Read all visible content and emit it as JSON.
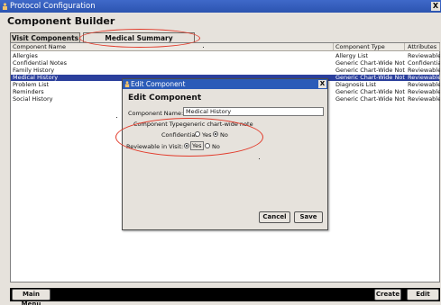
{
  "window": {
    "title": "Protocol Configuration",
    "close_glyph": "X"
  },
  "page": {
    "heading": "Component Builder"
  },
  "tabs": [
    {
      "label": "Visit Components"
    },
    {
      "label": "Medical Summary Components"
    }
  ],
  "table": {
    "columns": [
      "Component Name",
      "Component Type",
      "Attributes"
    ],
    "rows": [
      {
        "name": "Allergies",
        "type": "Allergy List",
        "attr": "Reviewable"
      },
      {
        "name": "Confidential Notes",
        "type": "Generic Chart-Wide Note",
        "attr": "Confidential"
      },
      {
        "name": "Family History",
        "type": "Generic Chart-Wide Note",
        "attr": "Reviewable"
      },
      {
        "name": "Medical History",
        "type": "Generic Chart-Wide Note",
        "attr": "Reviewable"
      },
      {
        "name": "Problem List",
        "type": "Diagnosis List",
        "attr": "Reviewable"
      },
      {
        "name": "Reminders",
        "type": "Generic Chart-Wide Note",
        "attr": "Reviewable"
      },
      {
        "name": "Social History",
        "type": "Generic Chart-Wide Note",
        "attr": "Reviewable"
      }
    ]
  },
  "dialog": {
    "title": "Edit Component",
    "close_glyph": "X",
    "heading": "Edit Component",
    "name_label": "Component Name:",
    "name_value": "Medical History",
    "type_label": "Component Type:",
    "type_value": "generic chart-wide note",
    "confidential_label": "Confidential:",
    "reviewable_label": "Reviewable in Visit:",
    "yes": "Yes",
    "no": "No",
    "confidential_selected": "No",
    "reviewable_selected": "Yes",
    "cancel": "Cancel",
    "save": "Save"
  },
  "bottom_bar": {
    "main_menu": "Main Menu",
    "create": "Create",
    "edit": "Edit"
  },
  "colors": {
    "titlebar": "#2c54b0",
    "selection": "#2b3f9c",
    "annotation": "#e23a2a"
  }
}
